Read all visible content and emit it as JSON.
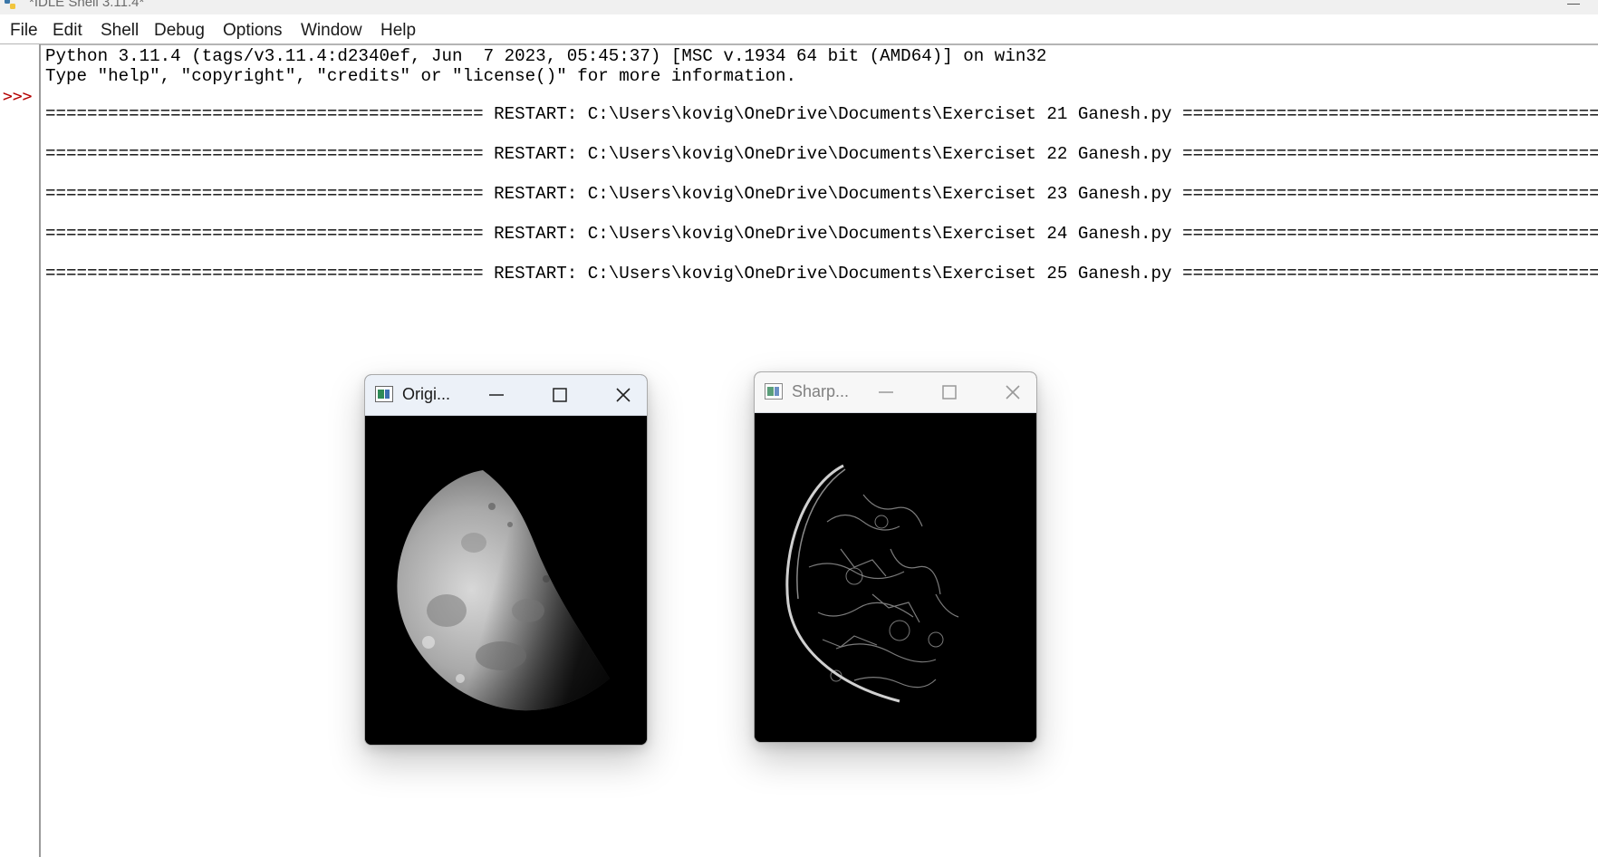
{
  "window": {
    "title": "*IDLE Shell 3.11.4*"
  },
  "menu": [
    "File",
    "Edit",
    "Shell",
    "Debug",
    "Options",
    "Window",
    "Help"
  ],
  "shell": {
    "prompt": ">>>",
    "banner": [
      "Python 3.11.4 (tags/v3.11.4:d2340ef, Jun  7 2023, 05:45:37) [MSC v.1934 64 bit (AMD64)] on win32",
      "Type \"help\", \"copyright\", \"credits\" or \"license()\" for more information."
    ],
    "restarts": [
      "========================================== RESTART: C:\\Users\\kovig\\OneDrive\\Documents\\Exerciset 21 Ganesh.py ==========================================",
      "========================================== RESTART: C:\\Users\\kovig\\OneDrive\\Documents\\Exerciset 22 Ganesh.py ==========================================",
      "========================================== RESTART: C:\\Users\\kovig\\OneDrive\\Documents\\Exerciset 23 Ganesh.py ==========================================",
      "========================================== RESTART: C:\\Users\\kovig\\OneDrive\\Documents\\Exerciset 24 Ganesh.py ==========================================",
      "========================================== RESTART: C:\\Users\\kovig\\OneDrive\\Documents\\Exerciset 25 Ganesh.py =========================================="
    ]
  },
  "windows": [
    {
      "title": "Origi...",
      "state": "active"
    },
    {
      "title": "Sharp...",
      "state": "inactive"
    }
  ],
  "icons": {
    "app": "python-feather-icon",
    "window": "opencv-window-icon",
    "minimize": "minimize-icon",
    "maximize": "maximize-icon",
    "close": "close-icon"
  }
}
